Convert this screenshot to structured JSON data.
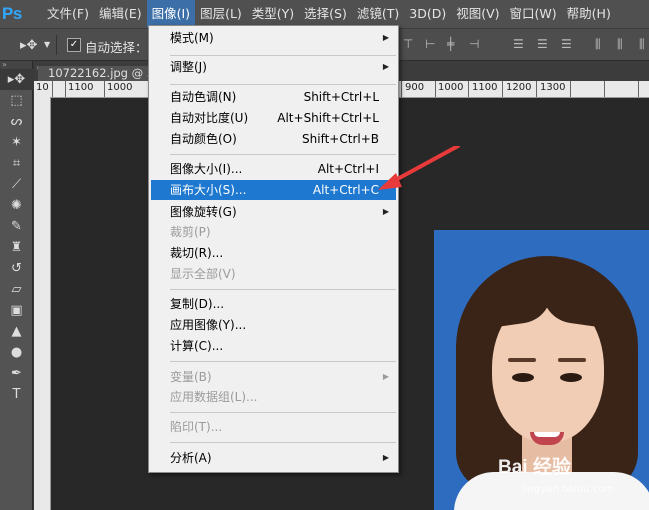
{
  "app": {
    "logo": "Ps"
  },
  "menubar": {
    "items": [
      "文件(F)",
      "编辑(E)",
      "图像(I)",
      "图层(L)",
      "类型(Y)",
      "选择(S)",
      "滤镜(T)",
      "3D(D)",
      "视图(V)",
      "窗口(W)",
      "帮助(H)"
    ],
    "active_index": 2
  },
  "options": {
    "auto_select_label": "自动选择：",
    "auto_select_checked": true
  },
  "document": {
    "tab_label": "10722162.jpg @ 3"
  },
  "ruler": {
    "labels": [
      "10",
      "1100",
      "1000",
      "900",
      "1000",
      "1100",
      "1200",
      "1300"
    ]
  },
  "menu": {
    "items": [
      {
        "label": "模式(M)",
        "shortcut": "",
        "submenu": true,
        "disabled": false
      },
      {
        "label": "调整(J)",
        "shortcut": "",
        "submenu": true,
        "disabled": false
      },
      {
        "label": "自动色调(N)",
        "shortcut": "Shift+Ctrl+L",
        "submenu": false,
        "disabled": false
      },
      {
        "label": "自动对比度(U)",
        "shortcut": "Alt+Shift+Ctrl+L",
        "submenu": false,
        "disabled": false
      },
      {
        "label": "自动颜色(O)",
        "shortcut": "Shift+Ctrl+B",
        "submenu": false,
        "disabled": false
      },
      {
        "label": "图像大小(I)...",
        "shortcut": "Alt+Ctrl+I",
        "submenu": false,
        "disabled": false
      },
      {
        "label": "画布大小(S)...",
        "shortcut": "Alt+Ctrl+C",
        "submenu": false,
        "disabled": false,
        "highlighted": true
      },
      {
        "label": "图像旋转(G)",
        "shortcut": "",
        "submenu": true,
        "disabled": false
      },
      {
        "label": "裁剪(P)",
        "shortcut": "",
        "submenu": false,
        "disabled": true
      },
      {
        "label": "裁切(R)...",
        "shortcut": "",
        "submenu": false,
        "disabled": false
      },
      {
        "label": "显示全部(V)",
        "shortcut": "",
        "submenu": false,
        "disabled": true
      },
      {
        "label": "复制(D)...",
        "shortcut": "",
        "submenu": false,
        "disabled": false
      },
      {
        "label": "应用图像(Y)...",
        "shortcut": "",
        "submenu": false,
        "disabled": false
      },
      {
        "label": "计算(C)...",
        "shortcut": "",
        "submenu": false,
        "disabled": false
      },
      {
        "label": "变量(B)",
        "shortcut": "",
        "submenu": true,
        "disabled": true
      },
      {
        "label": "应用数据组(L)...",
        "shortcut": "",
        "submenu": false,
        "disabled": true
      },
      {
        "label": "陷印(T)...",
        "shortcut": "",
        "submenu": false,
        "disabled": true
      },
      {
        "label": "分析(A)",
        "shortcut": "",
        "submenu": true,
        "disabled": false
      }
    ]
  },
  "watermark": {
    "brand": "Bai 经验",
    "url": "jingyan.baidu.com"
  },
  "colors": {
    "highlight": "#1e78cf",
    "photo_bg": "#2e6cbf",
    "arrow": "#e83a3a"
  }
}
